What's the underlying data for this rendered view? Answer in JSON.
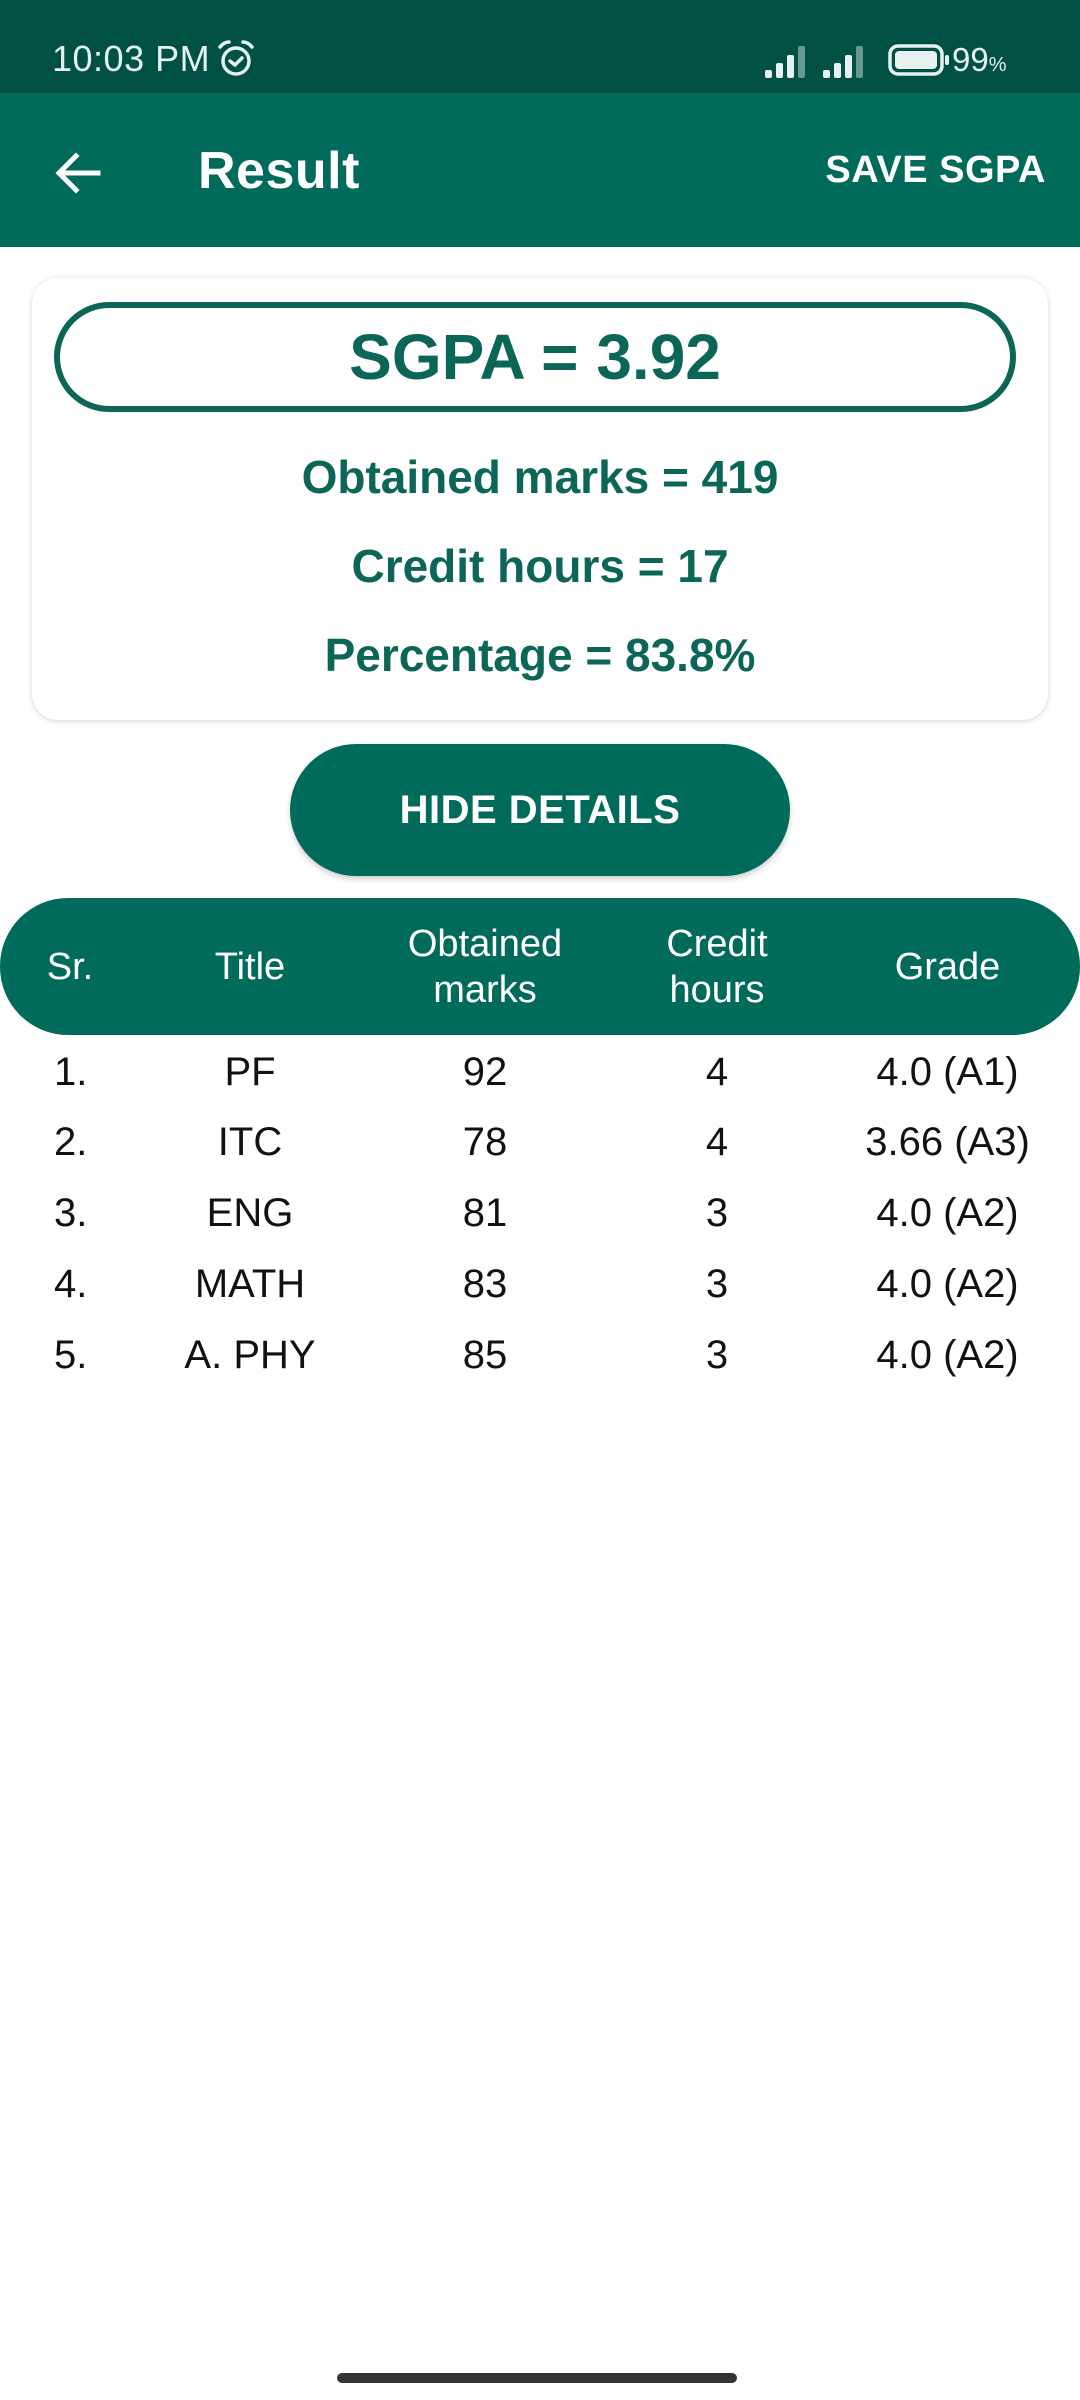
{
  "status_bar": {
    "time": "10:03 PM",
    "alarm_icon": "alarm-clock-icon",
    "signal_icons": [
      "signal-sim1-icon",
      "signal-sim2-icon"
    ],
    "battery_icon": "battery-icon",
    "battery_percent": "99",
    "battery_unit": "%"
  },
  "app_bar": {
    "back_icon": "arrow-back-icon",
    "title": "Result",
    "action_label": "SAVE SGPA"
  },
  "summary": {
    "sgpa": "SGPA = 3.92",
    "obtained_marks": "Obtained marks = 419",
    "credit_hours": "Credit hours = 17",
    "percentage": "Percentage = 83.8%"
  },
  "toggle_button": {
    "label": "HIDE DETAILS"
  },
  "table": {
    "headers": [
      "Sr.",
      "Title",
      "Obtained marks",
      "Credit hours",
      "Grade"
    ],
    "rows": [
      {
        "sr": "1.",
        "title": "PF",
        "marks": "92",
        "credits": "4",
        "grade": "4.0 (A1)"
      },
      {
        "sr": "2.",
        "title": "ITC",
        "marks": "78",
        "credits": "4",
        "grade": "3.66 (A3)"
      },
      {
        "sr": "3.",
        "title": "ENG",
        "marks": "81",
        "credits": "3",
        "grade": "4.0 (A2)"
      },
      {
        "sr": "4.",
        "title": "MATH",
        "marks": "83",
        "credits": "3",
        "grade": "4.0 (A2)"
      },
      {
        "sr": "5.",
        "title": "A. PHY",
        "marks": "85",
        "credits": "3",
        "grade": "4.0 (A2)"
      }
    ]
  },
  "colors": {
    "status_bar": "#005144",
    "primary": "#006a5b",
    "accent_text": "#0b6657"
  }
}
